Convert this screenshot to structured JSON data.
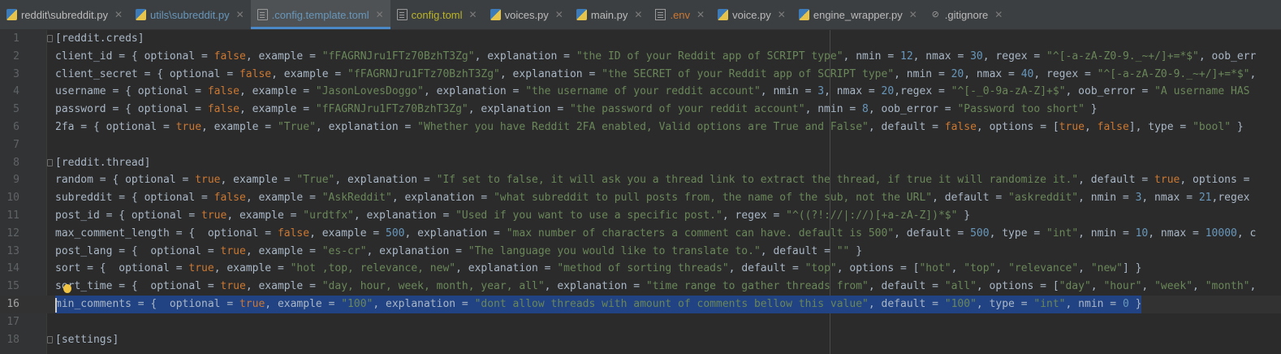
{
  "tabs": [
    {
      "label": "reddit\\subreddit.py",
      "icon": "python-file-icon",
      "color": "white",
      "underline": false,
      "active": false
    },
    {
      "label": "utils\\subreddit.py",
      "icon": "python-file-icon",
      "color": "blue",
      "underline": false,
      "active": false
    },
    {
      "label": ".config.template.toml",
      "icon": "toml-file-icon",
      "color": "blue",
      "underline": false,
      "active": true
    },
    {
      "label": "config.toml",
      "icon": "toml-file-icon",
      "color": "yellow",
      "underline": false,
      "active": false
    },
    {
      "label": "voices.py",
      "icon": "python-file-icon",
      "color": "white",
      "underline": false,
      "active": false
    },
    {
      "label": "main.py",
      "icon": "python-file-icon",
      "color": "white",
      "underline": false,
      "active": false
    },
    {
      "label": ".env",
      "icon": "env-file-icon",
      "color": "orange",
      "underline": false,
      "active": false
    },
    {
      "label": "voice.py",
      "icon": "python-file-icon",
      "color": "white",
      "underline": false,
      "active": false
    },
    {
      "label": "engine_wrapper.py",
      "icon": "python-file-icon",
      "color": "white",
      "underline": false,
      "active": false
    },
    {
      "label": ".gitignore",
      "icon": "gitignore-file-icon",
      "color": "white",
      "underline": false,
      "active": false
    }
  ],
  "close_glyph": "✕",
  "editor": {
    "current_line": 16,
    "lines": [
      {
        "n": "1",
        "t": [
          [
            "p",
            "[reddit.creds]"
          ]
        ]
      },
      {
        "n": "2",
        "t": [
          [
            "p",
            "client_id = { optional = "
          ],
          [
            "k",
            "false"
          ],
          [
            "p",
            ", example = "
          ],
          [
            "s",
            "\"fFAGRNJru1FTz70BzhT3Zg\""
          ],
          [
            "p",
            ", explanation = "
          ],
          [
            "s",
            "\"the ID of your Reddit app of SCRIPT type\""
          ],
          [
            "p",
            ", nmin = "
          ],
          [
            "n",
            "12"
          ],
          [
            "p",
            ", nmax = "
          ],
          [
            "n",
            "30"
          ],
          [
            "p",
            ", regex = "
          ],
          [
            "s",
            "\"^[-a-zA-Z0-9._~+/]+=*$\""
          ],
          [
            "p",
            ", oob_err"
          ]
        ]
      },
      {
        "n": "3",
        "t": [
          [
            "p",
            "client_secret = { optional = "
          ],
          [
            "k",
            "false"
          ],
          [
            "p",
            ", example = "
          ],
          [
            "s",
            "\"fFAGRNJru1FTz70BzhT3Zg\""
          ],
          [
            "p",
            ", explanation = "
          ],
          [
            "s",
            "\"the SECRET of your Reddit app of SCRIPT type\""
          ],
          [
            "p",
            ", nmin = "
          ],
          [
            "n",
            "20"
          ],
          [
            "p",
            ", nmax = "
          ],
          [
            "n",
            "40"
          ],
          [
            "p",
            ", regex = "
          ],
          [
            "s",
            "\"^[-a-zA-Z0-9._~+/]+=*$\""
          ],
          [
            "p",
            ","
          ]
        ]
      },
      {
        "n": "4",
        "t": [
          [
            "p",
            "username = { optional = "
          ],
          [
            "k",
            "false"
          ],
          [
            "p",
            ", example = "
          ],
          [
            "s",
            "\"JasonLovesDoggo\""
          ],
          [
            "p",
            ", explanation = "
          ],
          [
            "s",
            "\"the username of your reddit account\""
          ],
          [
            "p",
            ", nmin = "
          ],
          [
            "n",
            "3"
          ],
          [
            "p",
            ", nmax = "
          ],
          [
            "n",
            "20"
          ],
          [
            "p",
            ",regex = "
          ],
          [
            "s",
            "\"^[-_0-9a-zA-Z]+$\""
          ],
          [
            "p",
            ", oob_error = "
          ],
          [
            "s",
            "\"A username HAS"
          ]
        ]
      },
      {
        "n": "5",
        "t": [
          [
            "p",
            "password = { optional = "
          ],
          [
            "k",
            "false"
          ],
          [
            "p",
            ", example = "
          ],
          [
            "s",
            "\"fFAGRNJru1FTz70BzhT3Zg\""
          ],
          [
            "p",
            ", explanation = "
          ],
          [
            "s",
            "\"the password of your reddit account\""
          ],
          [
            "p",
            ", nmin = "
          ],
          [
            "n",
            "8"
          ],
          [
            "p",
            ", oob_error = "
          ],
          [
            "s",
            "\"Password too short\""
          ],
          [
            "p",
            " }"
          ]
        ]
      },
      {
        "n": "6",
        "t": [
          [
            "p",
            "2fa = { optional = "
          ],
          [
            "k",
            "true"
          ],
          [
            "p",
            ", example = "
          ],
          [
            "s",
            "\"True\""
          ],
          [
            "p",
            ", explanation = "
          ],
          [
            "s",
            "\"Whether you have Reddit 2FA enabled, Valid options are True and False\""
          ],
          [
            "p",
            ", default = "
          ],
          [
            "k",
            "false"
          ],
          [
            "p",
            ", options = ["
          ],
          [
            "k",
            "true"
          ],
          [
            "p",
            ", "
          ],
          [
            "k",
            "false"
          ],
          [
            "p",
            "], type = "
          ],
          [
            "s",
            "\"bool\""
          ],
          [
            "p",
            " }"
          ]
        ]
      },
      {
        "n": "7",
        "t": []
      },
      {
        "n": "8",
        "t": [
          [
            "p",
            "[reddit.thread]"
          ]
        ]
      },
      {
        "n": "9",
        "t": [
          [
            "p",
            "random = { optional = "
          ],
          [
            "k",
            "true"
          ],
          [
            "p",
            ", example = "
          ],
          [
            "s",
            "\"True\""
          ],
          [
            "p",
            ", explanation = "
          ],
          [
            "s",
            "\"If set to false, it will ask you a thread link to extract the thread, if true it will randomize it.\""
          ],
          [
            "p",
            ", default = "
          ],
          [
            "k",
            "true"
          ],
          [
            "p",
            ", options ="
          ]
        ]
      },
      {
        "n": "10",
        "t": [
          [
            "p",
            "subreddit = { optional = "
          ],
          [
            "k",
            "false"
          ],
          [
            "p",
            ", example = "
          ],
          [
            "s",
            "\"AskReddit\""
          ],
          [
            "p",
            ", explanation = "
          ],
          [
            "s",
            "\"what subreddit to pull posts from, the name of the sub, not the URL\""
          ],
          [
            "p",
            ", default = "
          ],
          [
            "s",
            "\"askreddit\""
          ],
          [
            "p",
            ", nmin = "
          ],
          [
            "n",
            "3"
          ],
          [
            "p",
            ", nmax = "
          ],
          [
            "n",
            "21"
          ],
          [
            "p",
            ",regex"
          ]
        ]
      },
      {
        "n": "11",
        "t": [
          [
            "p",
            "post_id = { optional = "
          ],
          [
            "k",
            "true"
          ],
          [
            "p",
            ", example = "
          ],
          [
            "s",
            "\"urdtfx\""
          ],
          [
            "p",
            ", explanation = "
          ],
          [
            "s",
            "\"Used if you want to use a specific post.\""
          ],
          [
            "p",
            ", regex = "
          ],
          [
            "s",
            "\"^((?!://|://)[+a-zA-Z])*$\""
          ],
          [
            "p",
            " }"
          ]
        ]
      },
      {
        "n": "12",
        "t": [
          [
            "p",
            "max_comment_length = {  optional = "
          ],
          [
            "k",
            "false"
          ],
          [
            "p",
            ", example = "
          ],
          [
            "n",
            "500"
          ],
          [
            "p",
            ", explanation = "
          ],
          [
            "s",
            "\"max number of characters a comment can have. default is 500\""
          ],
          [
            "p",
            ", default = "
          ],
          [
            "n",
            "500"
          ],
          [
            "p",
            ", type = "
          ],
          [
            "s",
            "\"int\""
          ],
          [
            "p",
            ", nmin = "
          ],
          [
            "n",
            "10"
          ],
          [
            "p",
            ", nmax = "
          ],
          [
            "n",
            "10000"
          ],
          [
            "p",
            ", c"
          ]
        ]
      },
      {
        "n": "13",
        "t": [
          [
            "p",
            "post_lang = {  optional = "
          ],
          [
            "k",
            "true"
          ],
          [
            "p",
            ", example = "
          ],
          [
            "s",
            "\"es-cr\""
          ],
          [
            "p",
            ", explanation = "
          ],
          [
            "s",
            "\"The language you would like to translate to.\""
          ],
          [
            "p",
            ", default = "
          ],
          [
            "s",
            "\"\""
          ],
          [
            "p",
            " }"
          ]
        ]
      },
      {
        "n": "14",
        "t": [
          [
            "p",
            "sort = {  optional = "
          ],
          [
            "k",
            "true"
          ],
          [
            "p",
            ", example = "
          ],
          [
            "s",
            "\"hot ,top, relevance, new\""
          ],
          [
            "p",
            ", explanation = "
          ],
          [
            "s",
            "\"method of sorting threads\""
          ],
          [
            "p",
            ", default = "
          ],
          [
            "s",
            "\"top\""
          ],
          [
            "p",
            ", options = ["
          ],
          [
            "s",
            "\"hot\""
          ],
          [
            "p",
            ", "
          ],
          [
            "s",
            "\"top\""
          ],
          [
            "p",
            ", "
          ],
          [
            "s",
            "\"relevance\""
          ],
          [
            "p",
            ", "
          ],
          [
            "s",
            "\"new\""
          ],
          [
            "p",
            "] }"
          ]
        ]
      },
      {
        "n": "15",
        "t": [
          [
            "p",
            "sort_time = {  optional = "
          ],
          [
            "k",
            "true"
          ],
          [
            "p",
            ", example = "
          ],
          [
            "s",
            "\"day, hour, week, month, year, all\""
          ],
          [
            "p",
            ", explanation = "
          ],
          [
            "s",
            "\"time range to gather threads from\""
          ],
          [
            "p",
            ", default = "
          ],
          [
            "s",
            "\"all\""
          ],
          [
            "p",
            ", options = ["
          ],
          [
            "s",
            "\"day\""
          ],
          [
            "p",
            ", "
          ],
          [
            "s",
            "\"hour\""
          ],
          [
            "p",
            ", "
          ],
          [
            "s",
            "\"week\""
          ],
          [
            "p",
            ", "
          ],
          [
            "s",
            "\"month\""
          ],
          [
            "p",
            ","
          ]
        ]
      },
      {
        "n": "16",
        "t": [
          [
            "p",
            "min_comments = {  optional = "
          ],
          [
            "k",
            "true"
          ],
          [
            "p",
            ", example = "
          ],
          [
            "s",
            "\"100\""
          ],
          [
            "p",
            ", explanation = "
          ],
          [
            "s",
            "\"dont allow threads with amount of comments bellow this value\""
          ],
          [
            "p",
            ", default = "
          ],
          [
            "s",
            "\"100\""
          ],
          [
            "p",
            ", type = "
          ],
          [
            "s",
            "\"int\""
          ],
          [
            "p",
            ", nmin = "
          ],
          [
            "n",
            "0"
          ],
          [
            "p",
            " }"
          ]
        ]
      },
      {
        "n": "17",
        "t": []
      },
      {
        "n": "18",
        "t": [
          [
            "p",
            "[settings]"
          ]
        ]
      }
    ]
  }
}
